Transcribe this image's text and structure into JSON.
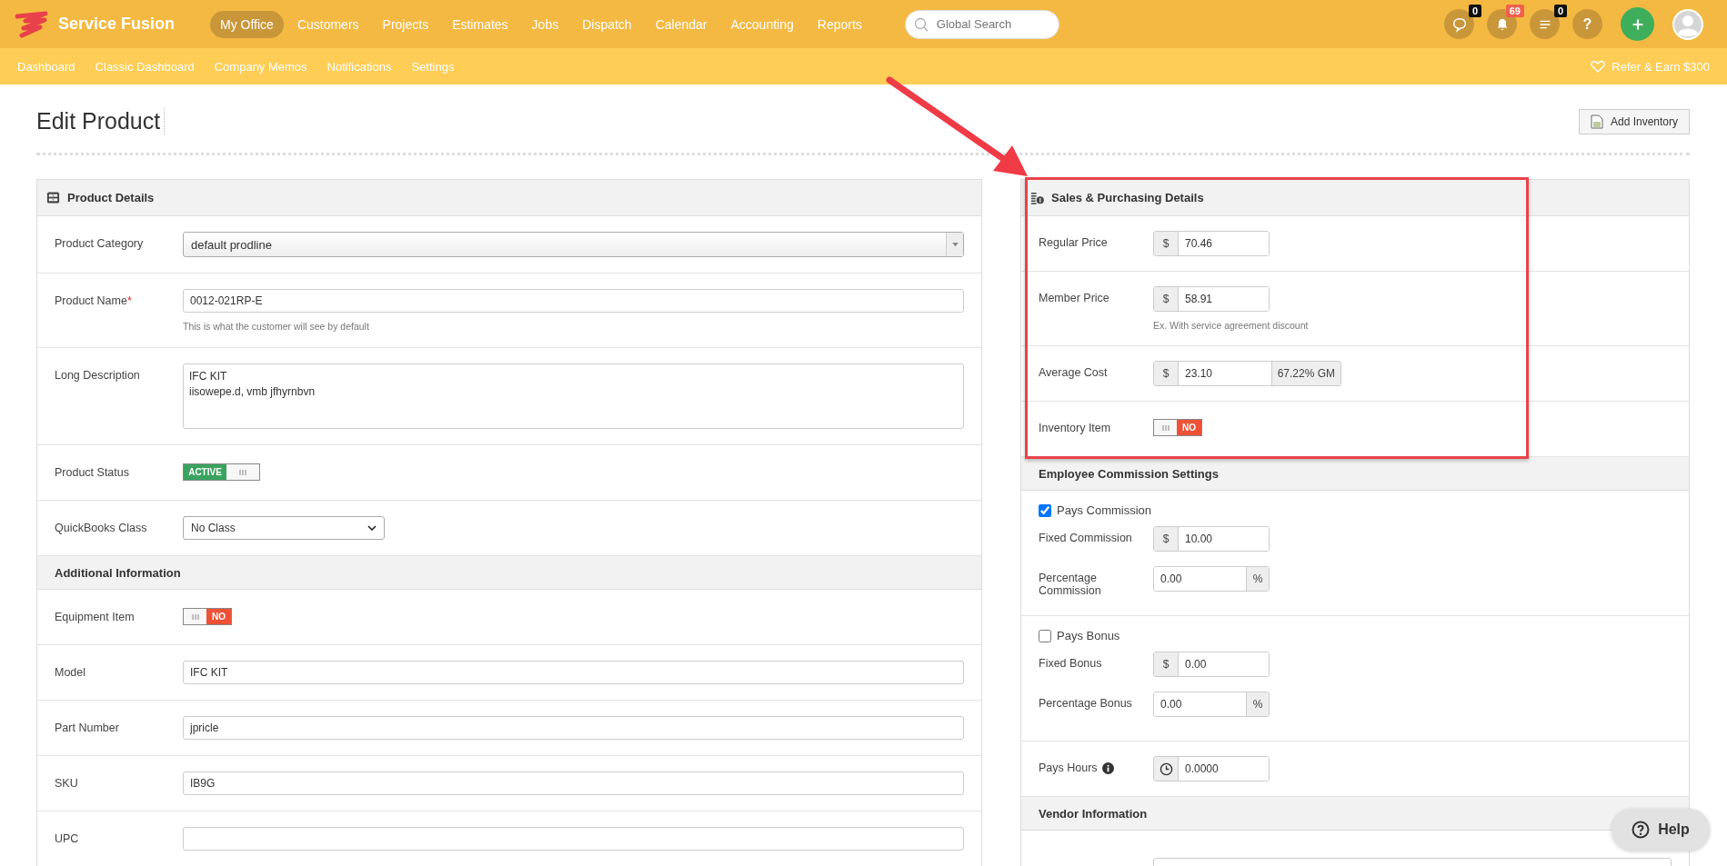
{
  "brand": {
    "name": "Service Fusion"
  },
  "main_nav": [
    {
      "label": "My Office",
      "selected": true
    },
    {
      "label": "Customers",
      "selected": false
    },
    {
      "label": "Projects",
      "selected": false
    },
    {
      "label": "Estimates",
      "selected": false
    },
    {
      "label": "Jobs",
      "selected": false
    },
    {
      "label": "Dispatch",
      "selected": false
    },
    {
      "label": "Calendar",
      "selected": false
    },
    {
      "label": "Accounting",
      "selected": false
    },
    {
      "label": "Reports",
      "selected": false
    }
  ],
  "search": {
    "placeholder": "Global Search"
  },
  "header_icons": [
    {
      "kind": "chat",
      "badge": "0",
      "color": "#111111"
    },
    {
      "kind": "bell",
      "badge": "69",
      "color": "#f0614a"
    },
    {
      "kind": "list",
      "badge": "0",
      "color": "#111111"
    },
    {
      "kind": "help",
      "glyph": "?"
    },
    {
      "kind": "add"
    },
    {
      "kind": "avatar"
    }
  ],
  "sub_nav": [
    {
      "label": "Dashboard"
    },
    {
      "label": "Classic Dashboard"
    },
    {
      "label": "Company Memos"
    },
    {
      "label": "Notifications"
    },
    {
      "label": "Settings"
    }
  ],
  "refer_link": "Refer & Earn $300",
  "page": {
    "title": "Edit Product",
    "add_inventory": "Add Inventory"
  },
  "product_details": {
    "title": "Product Details",
    "rows": [
      {
        "kind": "select",
        "label": "Product Category",
        "value": "default prodline"
      },
      {
        "kind": "text",
        "label": "Product Name",
        "required_mark": "*",
        "value": "0012-021RP-E",
        "hint": "This is what the customer will see by default"
      },
      {
        "kind": "textarea",
        "label": "Long Description",
        "lines": [
          "IFC KIT",
          "iisowepe.d, vmb jfhyrnbvn"
        ]
      },
      {
        "kind": "toggle",
        "label": "Product Status",
        "on": true,
        "text": "ACTIVE"
      },
      {
        "kind": "dropdown",
        "label": "QuickBooks Class",
        "value": "No Class"
      },
      {
        "kind": "section",
        "label": "Additional Information"
      },
      {
        "kind": "toggle",
        "label": "Equipment Item",
        "on": false,
        "text": "NO"
      },
      {
        "kind": "text",
        "label": "Model",
        "value": "IFC KIT"
      },
      {
        "kind": "text",
        "label": "Part Number",
        "value": "jpricle"
      },
      {
        "kind": "text",
        "label": "SKU",
        "value": "IB9G"
      },
      {
        "kind": "text",
        "label": "UPC"
      }
    ]
  },
  "sales": {
    "title": "Sales & Purchasing Details",
    "rows": [
      {
        "kind": "money",
        "label": "Regular Price",
        "prefix": "$",
        "value": "70.46"
      },
      {
        "kind": "money",
        "label": "Member Price",
        "prefix": "$",
        "value": "58.91",
        "hint": "Ex. With service agreement discount"
      },
      {
        "kind": "money",
        "label": "Average Cost",
        "prefix": "$",
        "value": "23.10",
        "suffix": "67.22% GM"
      },
      {
        "kind": "toggle",
        "label": "Inventory Item",
        "on": false,
        "text": "NO"
      }
    ]
  },
  "commission": {
    "title": "Employee Commission Settings",
    "groups": [
      {
        "checkbox": {
          "label": "Pays Commission",
          "checked": true
        },
        "fields": [
          {
            "label": "Fixed Commission",
            "prefix": "$",
            "value": "10.00"
          },
          {
            "label": "Percentage Commission",
            "suffix": "%",
            "value": "0.00"
          }
        ]
      },
      {
        "checkbox": {
          "label": "Pays Bonus",
          "checked": false
        },
        "fields": [
          {
            "label": "Fixed Bonus",
            "prefix": "$",
            "value": "0.00"
          },
          {
            "label": "Percentage Bonus",
            "suffix": "%",
            "value": "0.00"
          }
        ]
      }
    ],
    "pays_hours": {
      "label": "Pays Hours",
      "value": "0.0000"
    }
  },
  "vendor": {
    "title": "Vendor Information"
  },
  "help_button": "Help"
}
